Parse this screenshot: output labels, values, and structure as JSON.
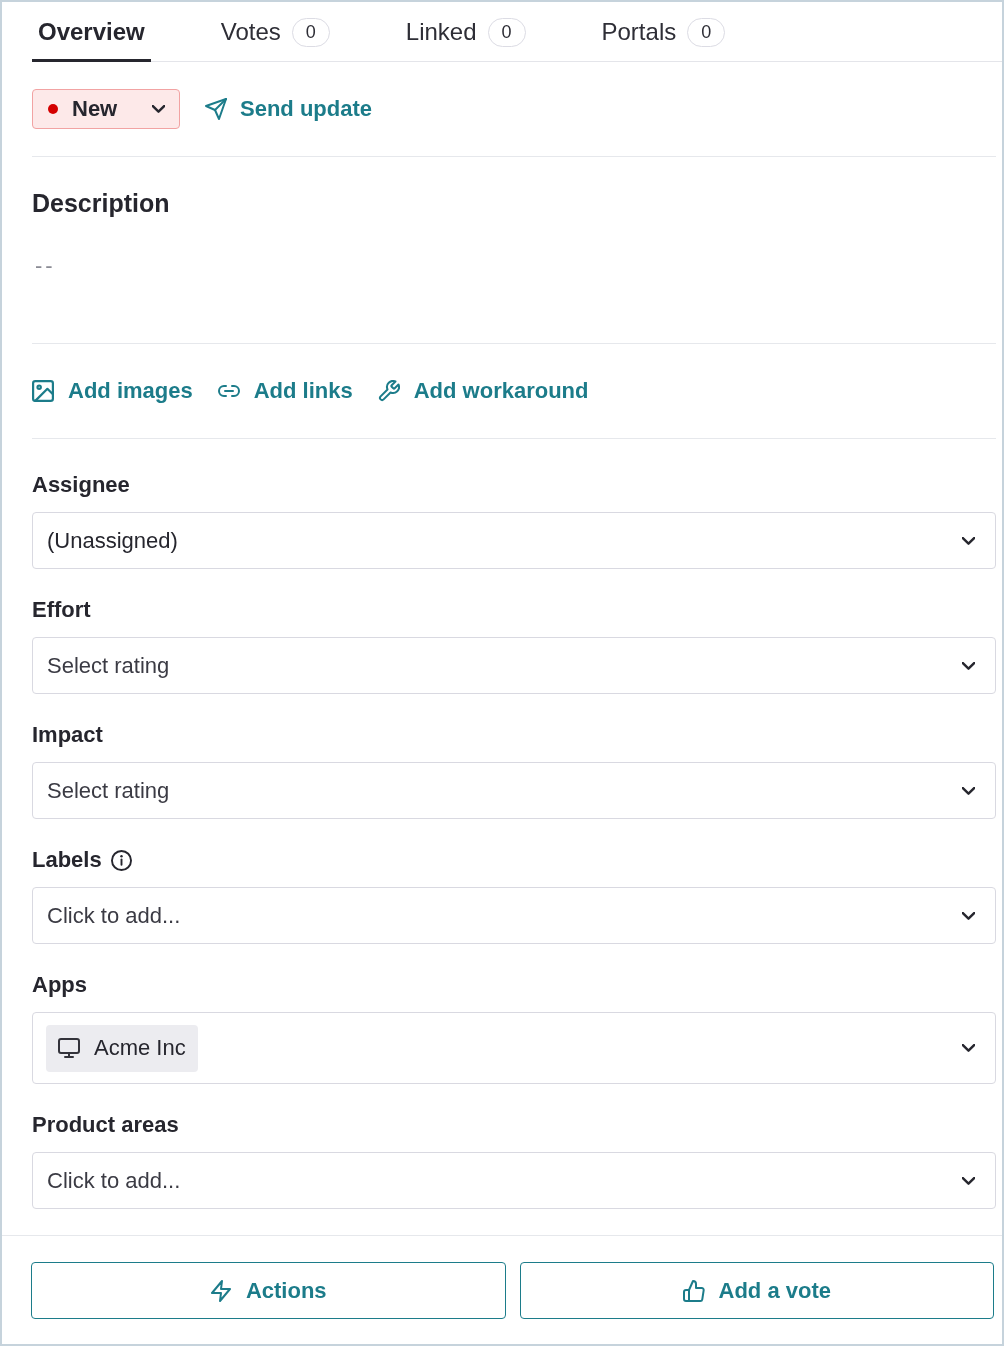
{
  "tabs": [
    {
      "label": "Overview",
      "selected": true
    },
    {
      "label": "Votes",
      "count": "0",
      "selected": false
    },
    {
      "label": "Linked",
      "count": "0",
      "selected": false
    },
    {
      "label": "Portals",
      "count": "0",
      "selected": false
    }
  ],
  "status": {
    "label": "New"
  },
  "send_update": {
    "label": "Send update"
  },
  "description": {
    "title": "Description",
    "value": "--"
  },
  "attachments": [
    {
      "kind": "images",
      "label": "Add images"
    },
    {
      "kind": "links",
      "label": "Add links"
    },
    {
      "kind": "workaround",
      "label": "Add workaround"
    }
  ],
  "fields": [
    {
      "label": "Assignee",
      "value": "(Unassigned)"
    },
    {
      "label": "Effort",
      "placeholder": "Select rating"
    },
    {
      "label": "Impact",
      "placeholder": "Select rating"
    },
    {
      "label": "Labels",
      "info": true,
      "placeholder": "Click to add..."
    },
    {
      "label": "Apps",
      "chips": [
        "Acme Inc"
      ]
    },
    {
      "label": "Product areas",
      "placeholder": "Click to add..."
    }
  ],
  "footer_buttons": [
    {
      "kind": "actions",
      "label": "Actions"
    },
    {
      "kind": "vote",
      "label": "Add a vote"
    }
  ]
}
